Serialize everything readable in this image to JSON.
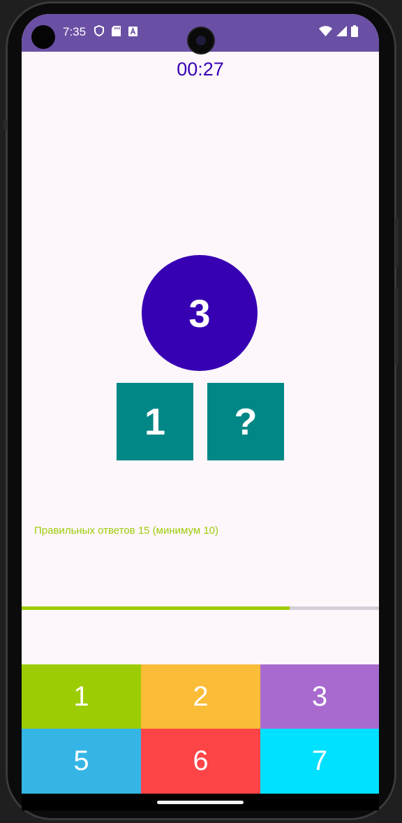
{
  "status_bar": {
    "time": "7:35",
    "background": "#6a50a4",
    "left_icons": [
      "shield-icon",
      "sd-card-icon",
      "keyboard-a-icon"
    ],
    "right_icons": [
      "wifi-icon",
      "signal-icon",
      "battery-icon"
    ]
  },
  "game": {
    "timer": "00:27",
    "target_number": "3",
    "left_box": "1",
    "right_box": "?",
    "score_text": "Правильных ответов 15 (минимум 10)",
    "progress_fraction": 0.75,
    "colors": {
      "primary": "#3700b3",
      "teal": "#018786",
      "accent_green": "#9ccc08",
      "background": "#fdf6fb"
    }
  },
  "keypad": {
    "keys": [
      {
        "label": "1",
        "color": "#9ccc04"
      },
      {
        "label": "2",
        "color": "#fbbc37"
      },
      {
        "label": "3",
        "color": "#a86ace"
      },
      {
        "label": "5",
        "color": "#35b5e5"
      },
      {
        "label": "6",
        "color": "#fd4447"
      },
      {
        "label": "7",
        "color": "#00e0ff"
      }
    ]
  }
}
